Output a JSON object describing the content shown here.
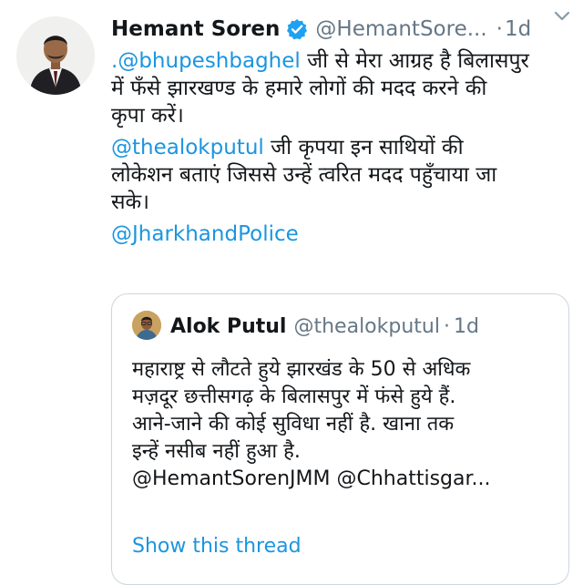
{
  "tweet": {
    "author": {
      "name": "Hemant Soren",
      "handle": "@HemantSore...",
      "verified": true,
      "separator": "·",
      "time": "1d"
    },
    "body": {
      "p1": {
        "prefix": ".",
        "mention": "@bhupeshbaghel",
        "line1_rest": " जी से मेरा आग्रह है बिलासपुर",
        "line2": "में फँसे झारखण्ड के हमारे लोगों की मदद करने की",
        "line3": "कृपा करें।"
      },
      "p2": {
        "mention": "@thealokputul",
        "line1_rest": " जी कृपया इन साथियों की",
        "line2": "लोकेशन बताएं जिससे उन्हें त्वरित मदद पहुँचाया जा",
        "line3": "सके।"
      },
      "p3": {
        "mention": "@JharkhandPolice"
      }
    },
    "quoted": {
      "name": "Alok Putul",
      "handle": "@thealokputul",
      "separator": "·",
      "time": "1d",
      "lines": [
        "महाराष्ट्र से लौटते हुये झारखंड के 50 से अधिक",
        "मज़दूर छत्तीसगढ़ के बिलासपुर में फंसे हुये हैं.",
        "आने-जाने की कोई सुविधा नहीं है. खाना तक",
        "इन्हें नसीब नहीं हुआ है.",
        "@HemantSorenJMM @Chhattisgar..."
      ],
      "show_thread": "Show this thread"
    }
  },
  "colors": {
    "text": "#14171a",
    "secondary": "#657786",
    "link": "#1b95e0",
    "verified": "#1da1f2",
    "border": "#ccd6dd"
  },
  "icons": {
    "verified": "verified-badge-icon",
    "caret": "chevron-down-icon"
  }
}
